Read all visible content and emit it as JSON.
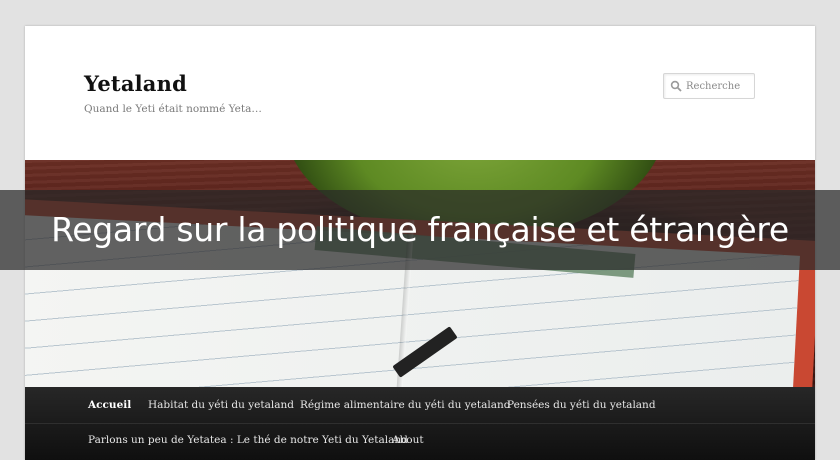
{
  "site": {
    "title": "Yetaland",
    "description": "Quand le Yeti était nommé Yeta…"
  },
  "search": {
    "placeholder": "Recherche",
    "icon": "magnifier-icon"
  },
  "banner": {
    "text": "Regard sur la politique française et étrangère"
  },
  "nav": {
    "items": [
      {
        "label": "Accueil",
        "current": true
      },
      {
        "label": "Habitat du yéti du yetaland"
      },
      {
        "label": "Régime alimentaire du yéti du yetaland"
      },
      {
        "label": "Pensées du yéti du yetaland"
      },
      {
        "label": "Parlons un peu de Yetatea : Le thé de notre Yeti du Yetaland"
      },
      {
        "label": "About"
      }
    ]
  }
}
